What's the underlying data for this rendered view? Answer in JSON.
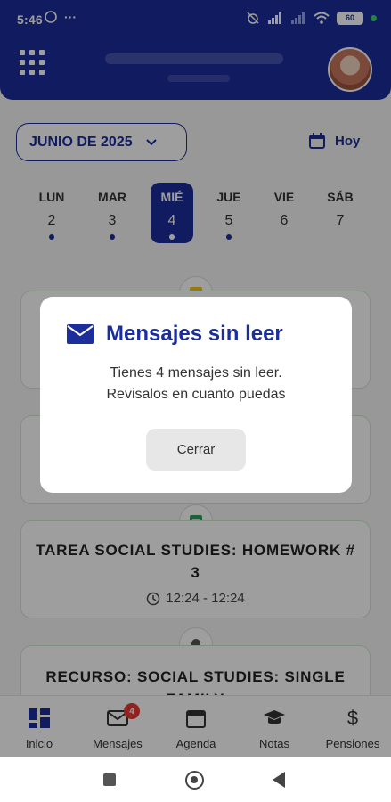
{
  "status_bar": {
    "time": "5:46",
    "more": "···",
    "battery": "60"
  },
  "calendar": {
    "month_label": "JUNIO DE 2025",
    "today_label": "Hoy",
    "days": [
      {
        "name": "LUN",
        "date": "2",
        "has_event": true
      },
      {
        "name": "MAR",
        "date": "3",
        "has_event": true
      },
      {
        "name": "MIÉ",
        "date": "4",
        "has_event": true,
        "selected": true
      },
      {
        "name": "JUE",
        "date": "5",
        "has_event": true
      },
      {
        "name": "VIE",
        "date": "6",
        "has_event": false
      },
      {
        "name": "SÁB",
        "date": "7",
        "has_event": false
      }
    ]
  },
  "timeline": [
    {
      "title": "TAREA SOCIAL STUDIES: HOMEWORK # 3",
      "time": "12:24 - 12:24",
      "icon": "assignment-icon"
    },
    {
      "title": "RECURSO: SOCIAL STUDIES: SINGLE FAMILY",
      "icon": "bell-icon"
    }
  ],
  "modal": {
    "title": "Mensajes sin leer",
    "line1": "Tienes 4 mensajes sin leer.",
    "line2": "Revisalos en cuanto puedas",
    "button": "Cerrar"
  },
  "bottom_nav": [
    {
      "label": "Inicio",
      "icon": "dashboard-icon"
    },
    {
      "label": "Mensajes",
      "icon": "mail-icon",
      "badge": "4"
    },
    {
      "label": "Agenda",
      "icon": "calendar-icon"
    },
    {
      "label": "Notas",
      "icon": "graduation-cap-icon"
    },
    {
      "label": "Pensiones",
      "icon": "dollar-icon"
    }
  ],
  "colors": {
    "primary": "#1c2e9b",
    "badge": "#e53935",
    "card_border": "#cfe9cf"
  }
}
